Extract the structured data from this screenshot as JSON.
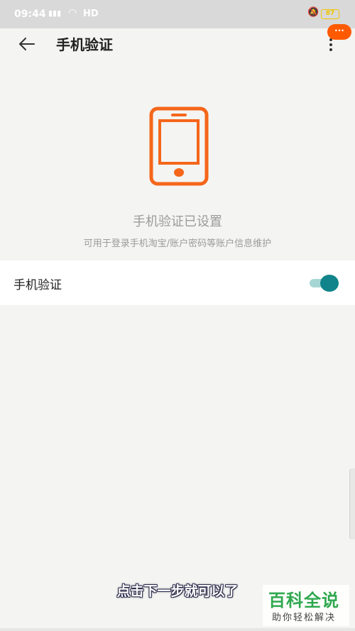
{
  "status_bar": {
    "time": "09:44",
    "network": "HD",
    "battery": "87"
  },
  "toolbar": {
    "title": "手机验证",
    "badge": "···"
  },
  "hero": {
    "title": "手机验证已设置",
    "description": "可用于登录手机淘宝/账户密码等账户信息维护"
  },
  "settings": {
    "phone_verification": {
      "label": "手机验证",
      "enabled": true
    }
  },
  "overlay": {
    "subtitle": "点击下一步就可以了",
    "watermark_main": "百科全说",
    "watermark_sub": "助你轻松解决"
  },
  "colors": {
    "accent_orange": "#ff5a00",
    "toggle_on": "#10848a",
    "toggle_track": "#a6d6d4"
  }
}
